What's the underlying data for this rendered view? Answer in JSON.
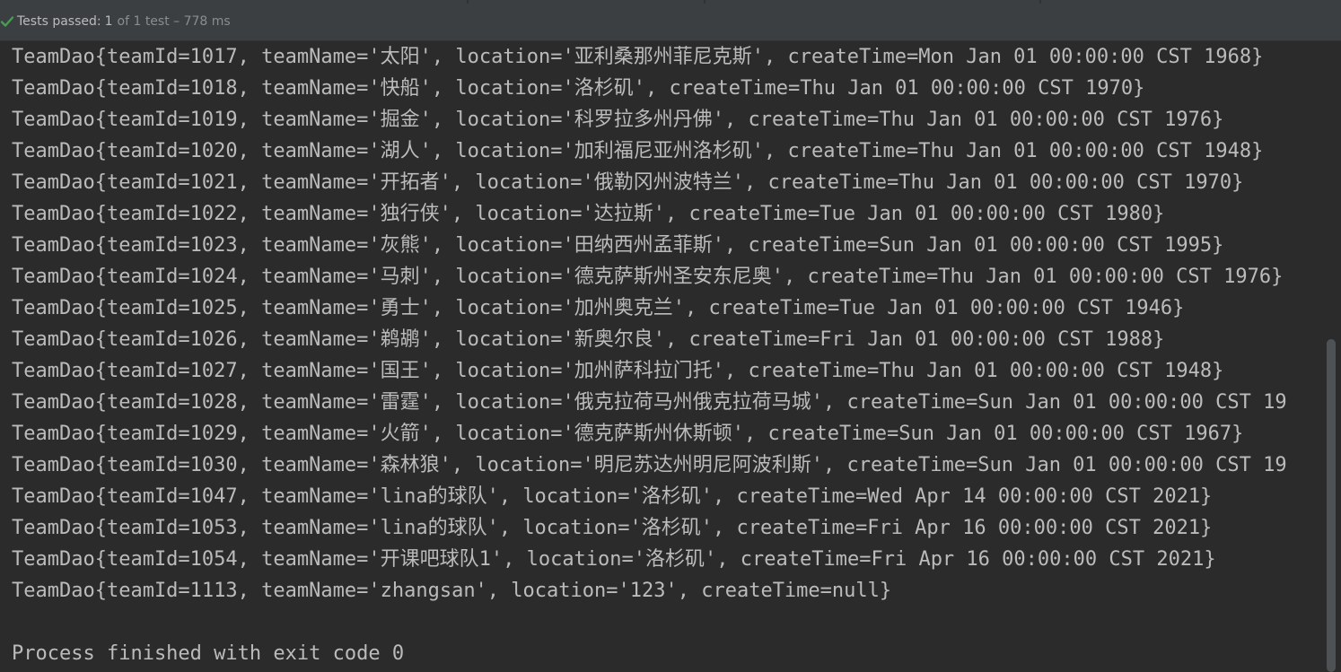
{
  "test_status": {
    "label": "Tests passed:",
    "passed": "1",
    "detail": "of 1 test – 778 ms",
    "icon": "check-icon",
    "accent": "#499c54"
  },
  "console": {
    "lines": [
      "TeamDao{teamId=1017, teamName='太阳', location='亚利桑那州菲尼克斯', createTime=Mon Jan 01 00:00:00 CST 1968}",
      "TeamDao{teamId=1018, teamName='快船', location='洛杉矶', createTime=Thu Jan 01 00:00:00 CST 1970}",
      "TeamDao{teamId=1019, teamName='掘金', location='科罗拉多州丹佛', createTime=Thu Jan 01 00:00:00 CST 1976}",
      "TeamDao{teamId=1020, teamName='湖人', location='加利福尼亚州洛杉矶', createTime=Thu Jan 01 00:00:00 CST 1948}",
      "TeamDao{teamId=1021, teamName='开拓者', location='俄勒冈州波特兰', createTime=Thu Jan 01 00:00:00 CST 1970}",
      "TeamDao{teamId=1022, teamName='独行侠', location='达拉斯', createTime=Tue Jan 01 00:00:00 CST 1980}",
      "TeamDao{teamId=1023, teamName='灰熊', location='田纳西州孟菲斯', createTime=Sun Jan 01 00:00:00 CST 1995}",
      "TeamDao{teamId=1024, teamName='马刺', location='德克萨斯州圣安东尼奥', createTime=Thu Jan 01 00:00:00 CST 1976}",
      "TeamDao{teamId=1025, teamName='勇士', location='加州奥克兰', createTime=Tue Jan 01 00:00:00 CST 1946}",
      "TeamDao{teamId=1026, teamName='鹈鹕', location='新奥尔良', createTime=Fri Jan 01 00:00:00 CST 1988}",
      "TeamDao{teamId=1027, teamName='国王', location='加州萨科拉门托', createTime=Thu Jan 01 00:00:00 CST 1948}",
      "TeamDao{teamId=1028, teamName='雷霆', location='俄克拉荷马州俄克拉荷马城', createTime=Sun Jan 01 00:00:00 CST 19",
      "TeamDao{teamId=1029, teamName='火箭', location='德克萨斯州休斯顿', createTime=Sun Jan 01 00:00:00 CST 1967}",
      "TeamDao{teamId=1030, teamName='森林狼', location='明尼苏达州明尼阿波利斯', createTime=Sun Jan 01 00:00:00 CST 19",
      "TeamDao{teamId=1047, teamName='lina的球队', location='洛杉矶', createTime=Wed Apr 14 00:00:00 CST 2021}",
      "TeamDao{teamId=1053, teamName='lina的球队', location='洛杉矶', createTime=Fri Apr 16 00:00:00 CST 2021}",
      "TeamDao{teamId=1054, teamName='开课吧球队1', location='洛杉矶', createTime=Fri Apr 16 00:00:00 CST 2021}",
      "TeamDao{teamId=1113, teamName='zhangsan', location='123', createTime=null}",
      "",
      "Process finished with exit code 0"
    ]
  }
}
